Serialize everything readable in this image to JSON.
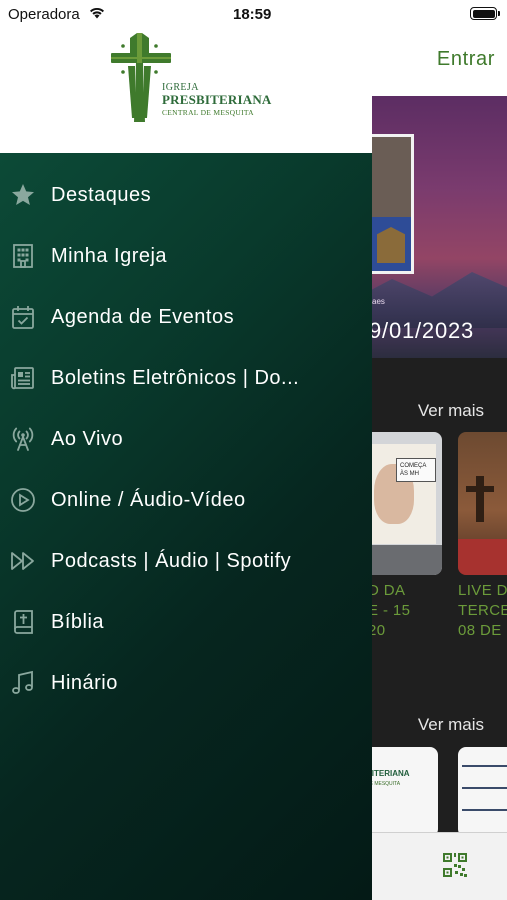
{
  "status_bar": {
    "carrier": "Operadora",
    "time": "18:59"
  },
  "logo": {
    "line1": "IGREJA",
    "line2": "PRESBITERIANA",
    "line3": "CENTRAL DE MESQUITA"
  },
  "header": {
    "login_label": "Entrar"
  },
  "hero": {
    "caption": "aes",
    "date": "9/01/2023"
  },
  "sections": {
    "see_more_label": "Ver mais"
  },
  "cards": [
    {
      "title_lines": [
        "D DA",
        "E - 15",
        "20"
      ],
      "note": "COMEÇA ÀS MH"
    },
    {
      "title_lines": [
        "LIVE D",
        "TERCE",
        "08 DE"
      ]
    }
  ],
  "doc_card": {
    "text1": "BITERIANA",
    "text2": "DE MESQUITA"
  },
  "menu": [
    {
      "label": "Destaques",
      "icon": "star-icon"
    },
    {
      "label": "Minha Igreja",
      "icon": "building-icon"
    },
    {
      "label": "Agenda de Eventos",
      "icon": "calendar-check-icon"
    },
    {
      "label": "Boletins Eletrônicos | Do...",
      "icon": "newspaper-icon"
    },
    {
      "label": "Ao Vivo",
      "icon": "broadcast-antenna-icon"
    },
    {
      "label": "Online / Áudio-Vídeo",
      "icon": "play-circle-icon"
    },
    {
      "label": "Podcasts | Áudio | Spotify",
      "icon": "fast-forward-icon"
    },
    {
      "label": "Bíblia",
      "icon": "bible-icon"
    },
    {
      "label": "Hinário",
      "icon": "music-note-icon"
    }
  ],
  "colors": {
    "brand_green": "#3f7a2c",
    "drawer_bg": "#0c4a37",
    "menu_icon": "#8aa89e"
  }
}
